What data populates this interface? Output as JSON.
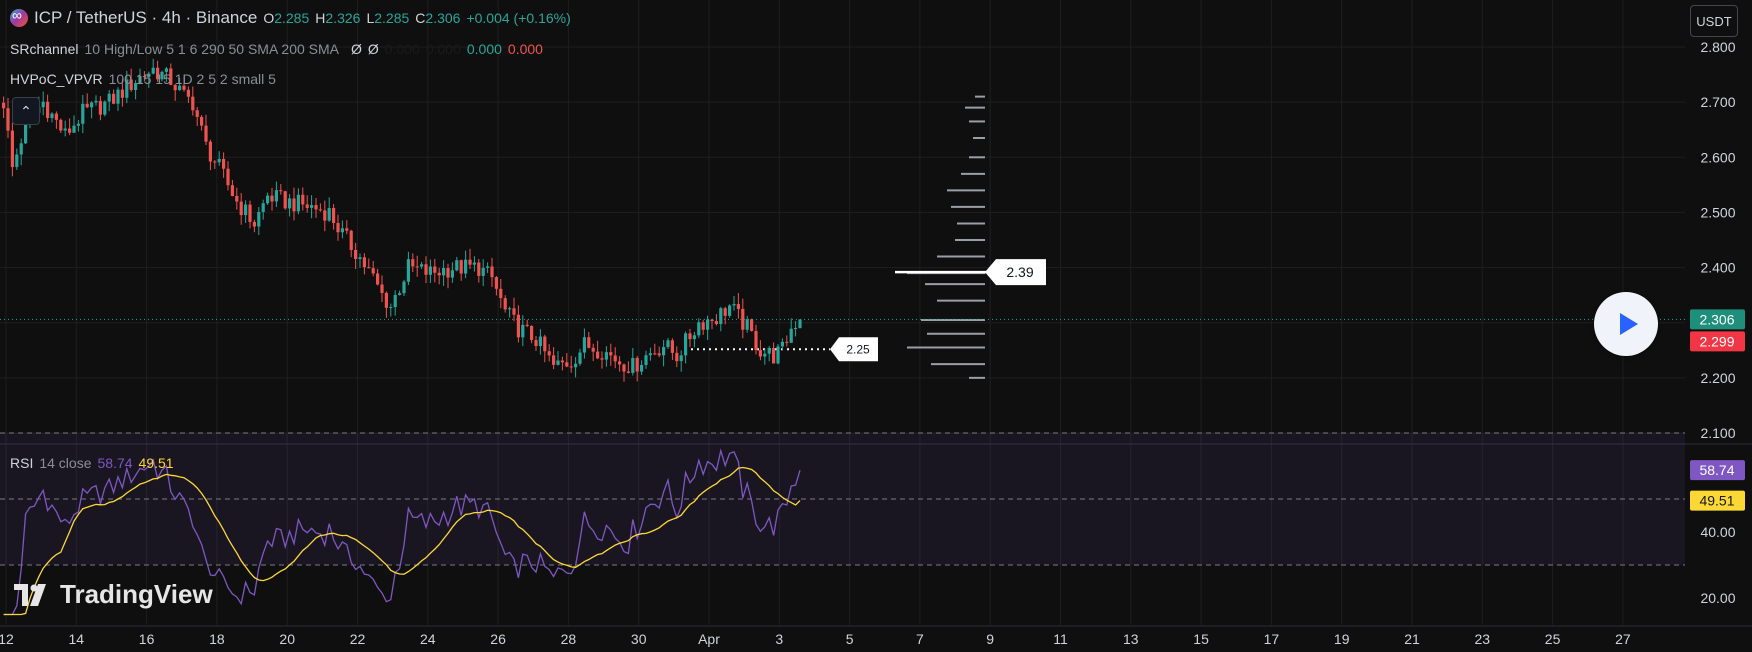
{
  "header": {
    "symbol": "ICP / TetherUS · 4h · Binance",
    "o_label": "O",
    "o_value": "2.285",
    "h_label": "H",
    "h_value": "2.326",
    "l_label": "L",
    "l_value": "2.285",
    "c_label": "C",
    "c_value": "2.306",
    "change": "+0.004 (+0.16%)"
  },
  "indicators": {
    "sr": {
      "name": "SRchannel",
      "params": "10 High/Low 5 1 6 290 50 SMA 200 SMA",
      "sym1": "Ø",
      "sym2": "Ø",
      "v1": "0.000",
      "v2": "0.000",
      "v3": "0.000",
      "v4": "0.000"
    },
    "hv": {
      "name": "HVPoC_VPVR",
      "params": "100 15 15 1D 2 5 2 small 5"
    },
    "rsi": {
      "name": "RSI",
      "params": "14 close",
      "value": "58.74",
      "ma": "49.51"
    }
  },
  "currency_button": "USDT",
  "logo_text": "TradingView",
  "colors": {
    "bg": "#0f0f0f",
    "up": "#26a69a",
    "down": "#ef5350",
    "rsi": "#7e57c2",
    "rsi_ma": "#fdd835",
    "grid": "#1e1e1e",
    "text": "#d1d4dc"
  },
  "chart_data": {
    "type": "candlestick",
    "price_axis": {
      "ticks": [
        "2.800",
        "2.700",
        "2.600",
        "2.500",
        "2.400",
        "2.300",
        "2.200",
        "2.100"
      ],
      "range": [
        2.05,
        2.83
      ]
    },
    "rsi_axis": {
      "ticks": [
        "20.00",
        "40.00"
      ],
      "range": [
        15,
        78
      ],
      "bands": [
        30,
        50,
        70
      ]
    },
    "x_ticks": [
      "12",
      "14",
      "16",
      "18",
      "20",
      "22",
      "24",
      "26",
      "28",
      "30",
      "Apr",
      "3",
      "5",
      "7",
      "9",
      "11",
      "13",
      "15",
      "17",
      "19",
      "21",
      "23",
      "25",
      "27"
    ],
    "anchors": [
      [
        0,
        2.7
      ],
      [
        2,
        2.58
      ],
      [
        5,
        2.66
      ],
      [
        9,
        2.7
      ],
      [
        14,
        2.64
      ],
      [
        18,
        2.68
      ],
      [
        24,
        2.7
      ],
      [
        30,
        2.74
      ],
      [
        34,
        2.76
      ],
      [
        38,
        2.74
      ],
      [
        41,
        2.71
      ],
      [
        43,
        2.7
      ],
      [
        46,
        2.62
      ],
      [
        49,
        2.58
      ],
      [
        53,
        2.52
      ],
      [
        57,
        2.48
      ],
      [
        60,
        2.53
      ],
      [
        64,
        2.52
      ],
      [
        70,
        2.51
      ],
      [
        74,
        2.5
      ],
      [
        77,
        2.46
      ],
      [
        80,
        2.43
      ],
      [
        84,
        2.38
      ],
      [
        86,
        2.35
      ],
      [
        88,
        2.33
      ],
      [
        92,
        2.4
      ],
      [
        97,
        2.39
      ],
      [
        102,
        2.4
      ],
      [
        108,
        2.4
      ],
      [
        111,
        2.38
      ],
      [
        114,
        2.32
      ],
      [
        117,
        2.29
      ],
      [
        121,
        2.27
      ],
      [
        125,
        2.22
      ],
      [
        129,
        2.23
      ],
      [
        132,
        2.26
      ],
      [
        136,
        2.25
      ],
      [
        140,
        2.23
      ],
      [
        143,
        2.22
      ],
      [
        146,
        2.24
      ],
      [
        150,
        2.26
      ],
      [
        153,
        2.24
      ],
      [
        158,
        2.3
      ],
      [
        162,
        2.31
      ],
      [
        165,
        2.33
      ],
      [
        169,
        2.29
      ],
      [
        172,
        2.25
      ],
      [
        175,
        2.24
      ],
      [
        177,
        2.25
      ],
      [
        179,
        2.29
      ],
      [
        181,
        2.31
      ]
    ],
    "candle_count": 182,
    "last_price": "2.306",
    "bid_price": "2.299",
    "poc_label": "2.39",
    "sr_label": "2.25",
    "rsi_last": "58.74",
    "rsi_ma_last": "49.51",
    "volume_profile": [
      {
        "price": 2.71,
        "w": 10
      },
      {
        "price": 2.69,
        "w": 20
      },
      {
        "price": 2.665,
        "w": 16
      },
      {
        "price": 2.635,
        "w": 12
      },
      {
        "price": 2.6,
        "w": 16
      },
      {
        "price": 2.57,
        "w": 24
      },
      {
        "price": 2.54,
        "w": 38
      },
      {
        "price": 2.51,
        "w": 34
      },
      {
        "price": 2.48,
        "w": 28
      },
      {
        "price": 2.45,
        "w": 30
      },
      {
        "price": 2.42,
        "w": 48
      },
      {
        "price": 2.39,
        "w": 78
      },
      {
        "price": 2.37,
        "w": 60
      },
      {
        "price": 2.34,
        "w": 48
      },
      {
        "price": 2.305,
        "w": 64
      },
      {
        "price": 2.28,
        "w": 58
      },
      {
        "price": 2.255,
        "w": 78
      },
      {
        "price": 2.225,
        "w": 54
      },
      {
        "price": 2.2,
        "w": 16
      }
    ]
  }
}
